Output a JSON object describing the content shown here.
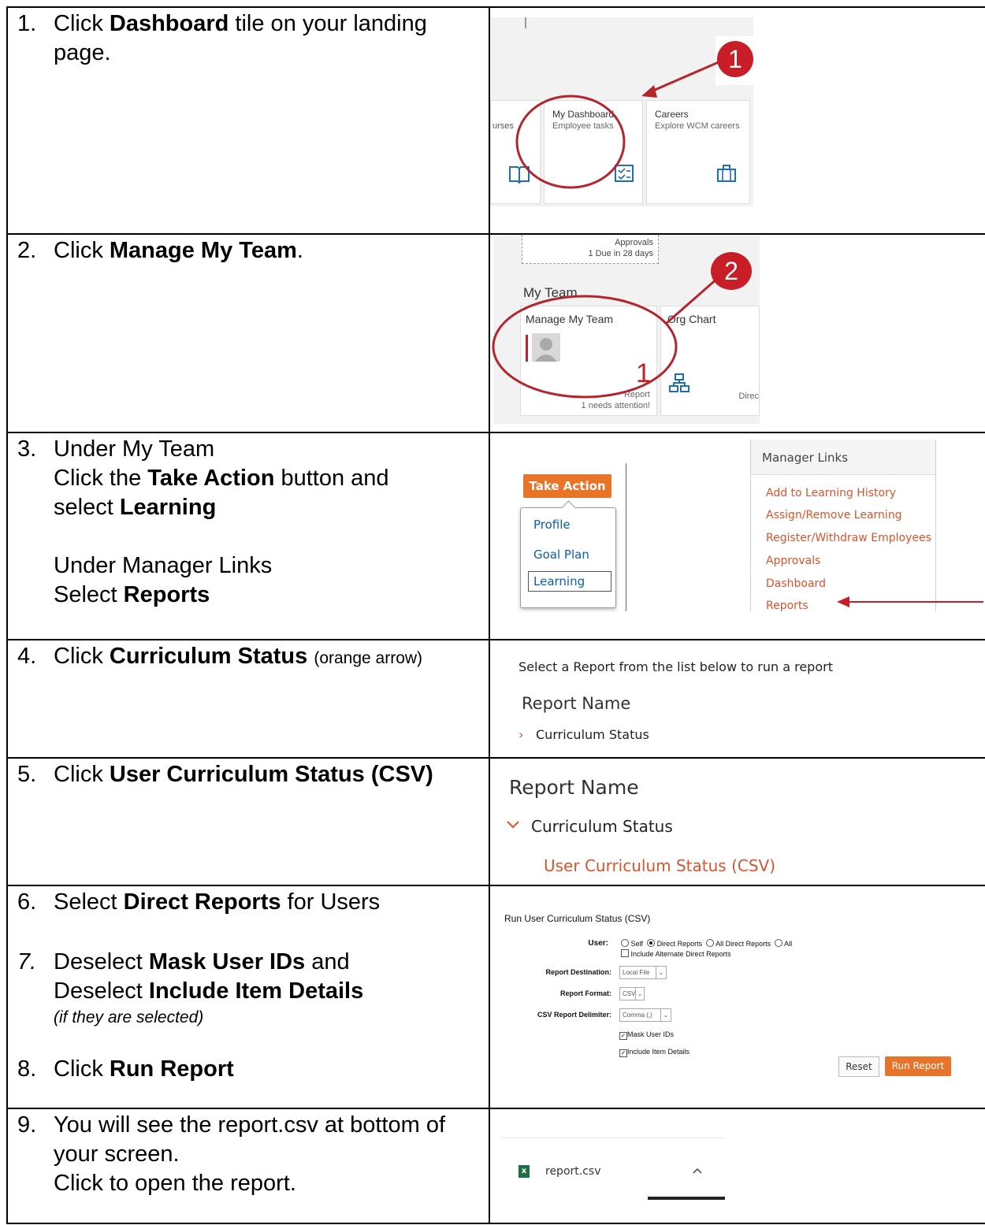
{
  "steps": [
    {
      "num": "1.",
      "pre": "Click ",
      "bold": "Dashboard",
      "post": " tile on your landing page."
    },
    {
      "num": "2.",
      "pre": "Click ",
      "bold": "Manage My Team",
      "post": "."
    },
    {
      "num": "3.",
      "l1": "Under My Team",
      "l2_pre": "Click the ",
      "l2_bold": "Take Action",
      "l2_post": " button and",
      "l3_pre": "select ",
      "l3_bold": "Learning",
      "l4": "Under Manager Links",
      "l5_pre": "Select ",
      "l5_bold": "Reports"
    },
    {
      "num": "4.",
      "pre": "Click ",
      "bold": "Curriculum Status",
      "note": "(orange arrow)"
    },
    {
      "num": "5.",
      "pre": "Click ",
      "bold": "User Curriculum Status (CSV)"
    },
    {
      "num": "6.",
      "pre": "Select ",
      "bold": "Direct Reports",
      "post": " for Users"
    },
    {
      "num": "7.",
      "l1_pre": "Deselect ",
      "l1_bold": "Mask User IDs",
      "l1_post": " and",
      "l2_pre": "Deselect ",
      "l2_bold": "Include Item Details",
      "l3": "(if they are selected)"
    },
    {
      "num": "8.",
      "pre": "Click ",
      "bold": "Run Report"
    },
    {
      "num": "9.",
      "l1": "You will see the report.csv at bottom of your screen.",
      "l2": "Click to open the report."
    }
  ],
  "shot1": {
    "tile_left": "urses",
    "tile1_title": "My Dashboard",
    "tile1_sub": "Employee tasks",
    "tile2_title": "Careers",
    "tile2_sub": "Explore WCM careers",
    "marker": "1"
  },
  "shot2": {
    "approvals": "Approvals",
    "due": "1 Due in 28 days",
    "section": "My Team",
    "tile1_title": "Manage My Team",
    "count": "1",
    "report": "Report",
    "attention": "1 needs attention!",
    "tile2_title": "Org Chart",
    "direct": "Direc",
    "marker": "2"
  },
  "shot3": {
    "button": "Take Action",
    "menu": [
      "Profile",
      "Goal Plan",
      "Learning"
    ],
    "links_title": "Manager Links",
    "links": [
      "Add to Learning History",
      "Assign/Remove Learning",
      "Register/Withdraw Employees",
      "Approvals",
      "Dashboard",
      "Reports"
    ]
  },
  "shot4": {
    "intro": "Select a Report from the list below to run a report",
    "header": "Report Name",
    "item": "Curriculum Status"
  },
  "shot5": {
    "header": "Report Name",
    "item": "Curriculum Status",
    "sub": "User Curriculum Status (CSV)"
  },
  "shot6": {
    "title": "Run User Curriculum Status (CSV)",
    "user_label": "User:",
    "opt_self": "Self",
    "opt_direct": "Direct Reports",
    "opt_all_direct": "All Direct Reports",
    "opt_all": "All",
    "include_alt": "Include Alternate Direct Reports",
    "dest_label": "Report Destination:",
    "dest_value": "Local File",
    "format_label": "Report Format:",
    "format_value": "CSV",
    "delim_label": "CSV Report Delimiter:",
    "delim_value": "Comma (,)",
    "mask": "Mask User IDs",
    "include_items": "Include Item Details",
    "reset": "Reset",
    "run": "Run Report"
  },
  "shot9": {
    "file": "report.csv",
    "excel_badge": "x"
  },
  "colors": {
    "sap_orange": "#e8742a",
    "sap_link": "#d9532c",
    "sap_blue": "#0a6ed1",
    "marker_red": "#c81e28",
    "circle_red": "#b3262d"
  }
}
